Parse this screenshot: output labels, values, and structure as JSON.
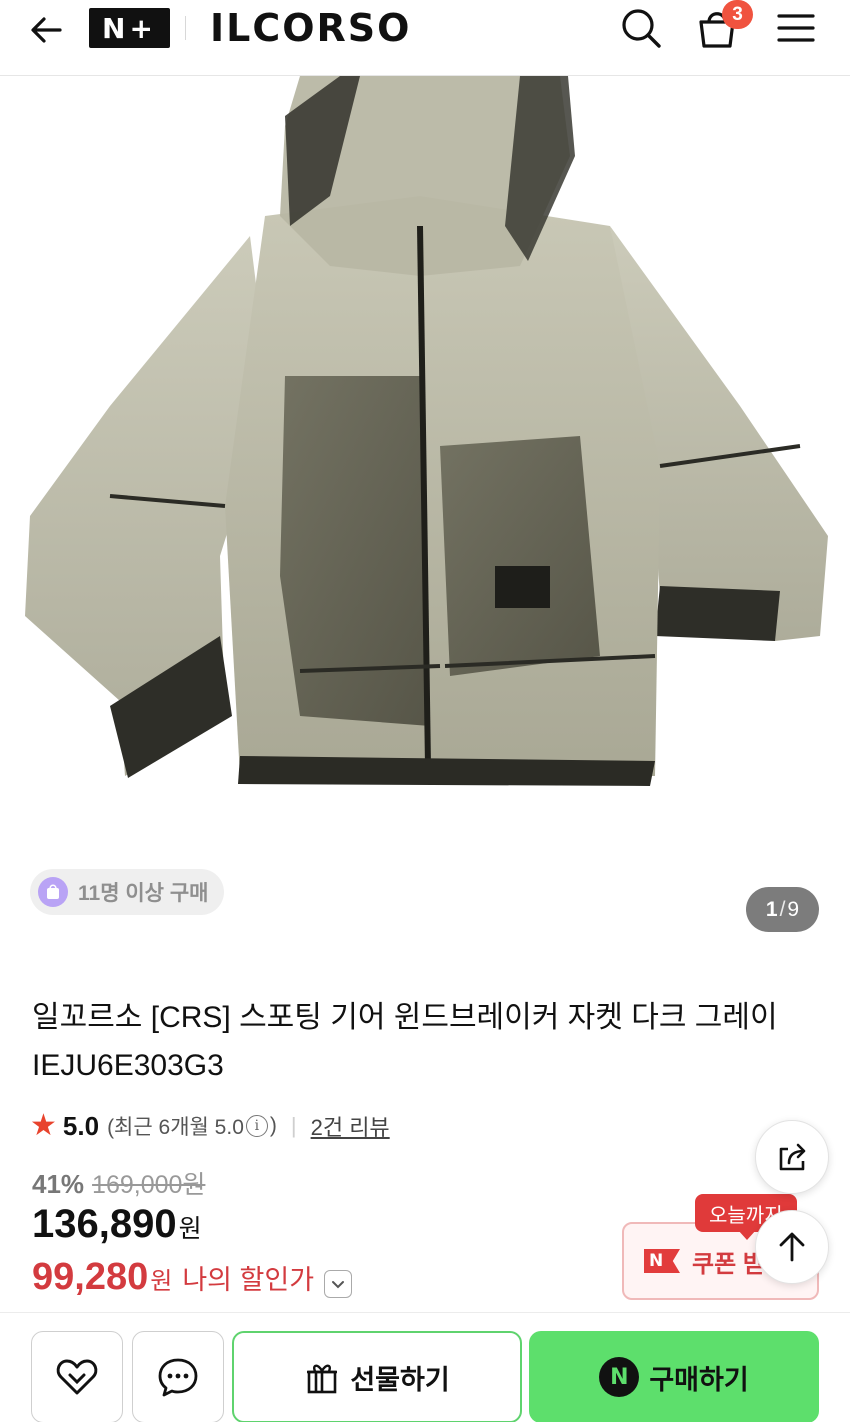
{
  "header": {
    "brand_badge": "N+",
    "store_name": "ILCORSO",
    "cart_count": "3"
  },
  "gallery": {
    "buy_count_label": "11명 이상 구매",
    "current_page": "1",
    "separator": "/",
    "total_pages": "9"
  },
  "product": {
    "title_line1": "일꼬르소 [CRS] 스포팅 기어 윈드브레이커 자켓 다크 그레이",
    "title_line2": "IEJU6E303G3",
    "rating": "5.0",
    "recent_rating": "(최근 6개월 5.0",
    "recent_rating_close": ")",
    "review_link": "2건 리뷰"
  },
  "price": {
    "discount_rate": "41%",
    "original_price": "169,000원",
    "sale_price": "136,890",
    "won": "원",
    "my_price": "99,280",
    "my_price_label": "나의 할인가"
  },
  "coupon": {
    "today_tag": "오늘까지",
    "label": "쿠폰 받기",
    "n_mark": "N"
  },
  "actions": {
    "gift_label": "선물하기",
    "buy_label": "구매하기",
    "npay_mark": "N"
  },
  "colors": {
    "accent_green": "#5ddf6c",
    "sale_red": "#d33b3f",
    "badge_orange": "#f0533f"
  }
}
